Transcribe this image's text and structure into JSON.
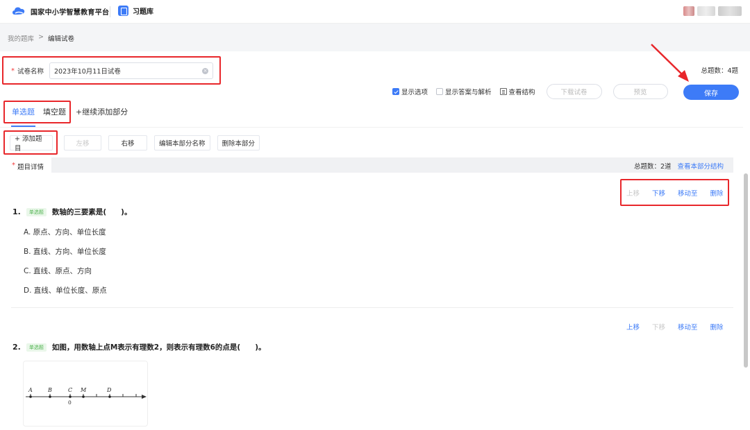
{
  "header": {
    "platform_title": "国家中小学智慧教育平台",
    "app_name": "习题库"
  },
  "breadcrumb": {
    "parent": "我的题库",
    "separator": ">",
    "current": "编辑试卷"
  },
  "paper": {
    "name_label": "试卷名称",
    "name_value": "2023年10月11日试卷",
    "total_label": "总题数：4题"
  },
  "toolbar": {
    "show_options": "显示选项",
    "show_answers": "显示答案与解析",
    "view_structure": "查看结构",
    "download": "下载试卷",
    "preview": "预览",
    "save": "保存"
  },
  "tabs": {
    "items": [
      "单选题",
      "填空题"
    ],
    "add_part": "+继续添加部分"
  },
  "section_ops": {
    "add_question": "+ 添加题目",
    "move_left": "左移",
    "move_right": "右移",
    "edit_name": "编辑本部分名称",
    "delete_part": "删除本部分"
  },
  "detail": {
    "label": "题目详情",
    "count": "总题数：2道",
    "view_structure": "查看本部分结构"
  },
  "question_ops": {
    "up": "上移",
    "down": "下移",
    "move_to": "移动至",
    "delete": "删除"
  },
  "questions": [
    {
      "number": "1.",
      "type": "单选题",
      "text": "数轴的三要素是(　　)。",
      "options": [
        "A. 原点、方向、单位长度",
        "B. 直线、方向、单位长度",
        "C. 直线、原点、方向",
        "D. 直线、单位长度、原点"
      ]
    },
    {
      "number": "2.",
      "type": "单选题",
      "text": "如图，用数轴上点M表示有理数2，则表示有理数6的点是(　　)。",
      "figure_labels": [
        "A",
        "B",
        "C",
        "M",
        "D",
        "0"
      ]
    }
  ],
  "colors": {
    "primary": "#3d7bf7",
    "annotation_red": "#e8262a",
    "required_star": "#f23b3b"
  }
}
